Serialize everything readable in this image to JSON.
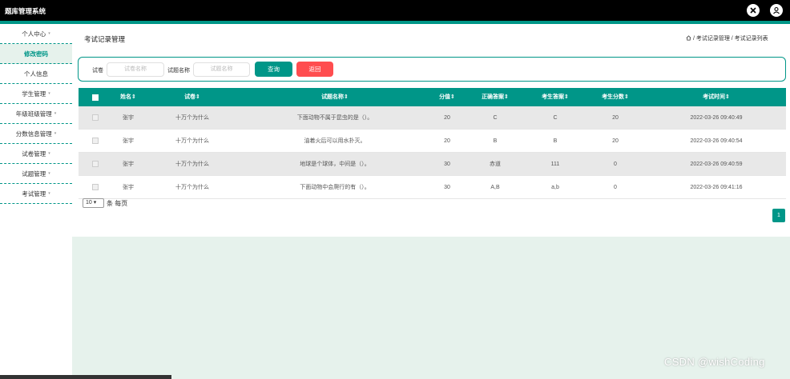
{
  "app": {
    "title": "题库管理系统"
  },
  "colors": {
    "accent": "#009688",
    "danger": "#ff4d4f",
    "page_bg": "#e6f2ec"
  },
  "topbar": {
    "icons": [
      "close-icon",
      "user-icon"
    ]
  },
  "sidebar": {
    "items": [
      {
        "label": "个人中心",
        "caret": "▾"
      },
      {
        "label": "修改密码",
        "sub": true
      },
      {
        "label": "个人信息",
        "sub": false
      },
      {
        "label": "学生管理",
        "caret": "▾"
      },
      {
        "label": "年级班级管理",
        "caret": "▾"
      },
      {
        "label": "分数信息管理",
        "caret": "▾"
      },
      {
        "label": "试卷管理",
        "caret": "▾"
      },
      {
        "label": "试题管理",
        "caret": "▾"
      },
      {
        "label": "考试管理",
        "caret": "▾"
      }
    ]
  },
  "header": {
    "page_title": "考试记录管理",
    "breadcrumb": " / 考试记录管理 / 考试记录列表"
  },
  "search": {
    "paper_label": "试卷",
    "paper_placeholder": "试卷名称",
    "question_label": "试题名称",
    "question_placeholder": "试题名称",
    "query_button": "查询",
    "back_button": "返回"
  },
  "table": {
    "columns": [
      "姓名⇕",
      "试卷⇕",
      "试题名称⇕",
      "分值⇕",
      "正确答案⇕",
      "考生答案⇕",
      "考生分数⇕",
      "考试时间⇕"
    ],
    "rows": [
      [
        "张宇",
        "十万个为什么",
        "下面动物不属于昆虫的是（）。",
        "20",
        "C",
        "C",
        "20",
        "2022-03-26 09:40:49"
      ],
      [
        "张宇",
        "十万个为什么",
        "油着火后可以用水扑灭。",
        "20",
        "B",
        "B",
        "20",
        "2022-03-26 09:40:54"
      ],
      [
        "张宇",
        "十万个为什么",
        "地球是个球体，中间是（）。",
        "30",
        "赤道",
        "111",
        "0",
        "2022-03-26 09:40:59"
      ],
      [
        "张宇",
        "十万个为什么",
        "下面动物中会爬行的有（）。",
        "30",
        "A,B",
        "a,b",
        "0",
        "2022-03-26 09:41:16"
      ]
    ]
  },
  "pagination": {
    "page_size": "10",
    "per_page_label": "条 每页",
    "current_page": "1"
  },
  "watermark": "CSDN @wishCoding"
}
